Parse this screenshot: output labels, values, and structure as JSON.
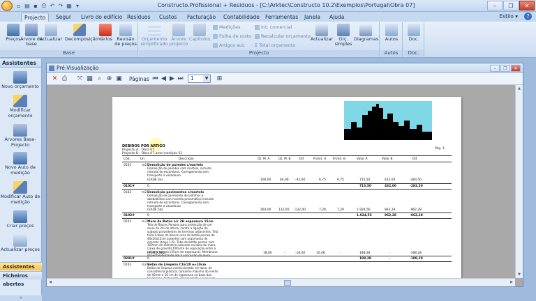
{
  "window": {
    "title": "Constructo.Profissional + Residuos - [C:\\Arktec\\Constructo 10.2\\Exemplos\\Portugal\\Obra 07]"
  },
  "tabs": [
    {
      "label": "Projecto",
      "active": true
    },
    {
      "label": "Segur"
    },
    {
      "label": "Livro do edifício"
    },
    {
      "label": "Resíduos"
    },
    {
      "label": "Custos"
    },
    {
      "label": "Facturação"
    },
    {
      "label": "Contabilidade"
    },
    {
      "label": "Ferramentas"
    },
    {
      "label": "Janela"
    },
    {
      "label": "Ajuda"
    }
  ],
  "style_label": "Estilo",
  "ribbon": {
    "base_group": "Base",
    "projecto_group": "Projecto",
    "autos_group": "Autos",
    "doc_group": "Doc.",
    "buttons": {
      "precos": "Preços",
      "arvore_base": "Árvore de base",
      "actualizar": "Actualizar",
      "decomposicao": "Decomposição",
      "varios": "Vários",
      "revisao_precos": "Revisão de preços",
      "orcamento_simplificado": "Orçamento simplificado",
      "arvore_projecto": "Árvore projecto",
      "capitulos": "Capítulos",
      "actualizar2": "Actualizar",
      "orc_simples": "Orç. simples",
      "diagramas": "Diagramas",
      "autos": "Autos",
      "doc": "Doc."
    },
    "small": {
      "medicoes": "Medições",
      "folha_rosto": "Folha de rosto",
      "artigos_aut": "Artigos aut.",
      "int_comercial": "Int. comercial",
      "recalcular": "Recalcular orçamento",
      "total_orcamento": "Total orçamento"
    }
  },
  "sidebar": {
    "header": "Assistentes",
    "items": [
      {
        "label": "Novo orçamento"
      },
      {
        "label": "Modificar orçamento"
      },
      {
        "label": "Árvores Base-Projecto"
      },
      {
        "label": "Novo Auto de medição"
      },
      {
        "label": "Modificar Auto de medição"
      },
      {
        "label": "Criar preços"
      },
      {
        "label": "Actualizar preços"
      }
    ],
    "bottom_selected": "Assistentes",
    "bottom_other": "Ficheiros abertos"
  },
  "preview": {
    "title": "Pré-Visualização",
    "pages_label": "Páginas",
    "page_value": "1"
  },
  "document": {
    "title": "DEBIDOS POR ARTIGO",
    "sub1": "Projecto A : Obra 07",
    "sub2": "Projecto B : Obra 07 auto medição 01",
    "page_label": "Pág. 1",
    "columns": [
      "Cód.",
      "Un",
      "Descrição",
      "Qt. M. A",
      "Qt. M. B",
      "Dif.",
      "P.Unit. A",
      "P.Unit. B",
      "Valor A",
      "Valor B",
      "Dif."
    ],
    "rows": [
      {
        "code": "0101",
        "un": "m2",
        "desc_title": "Demolição de paredes c/martelo",
        "desc": "Demolição de paredes com martelo, incluida retirada de escombros. Carregamento sem transporte a vazadouro.",
        "ref": "(EADE.3a)",
        "qa": "106,00",
        "qb": "64,00",
        "dif": "-42,00",
        "pa": "6,75",
        "pb": "6,75",
        "va": "715,50",
        "vb": "432,00",
        "vd": "-283,50",
        "sum_code": "0101#",
        "sum_q": "0",
        "sum_va": "715,50",
        "sum_vb": "432,00",
        "sum_vd": "-283,50"
      },
      {
        "code": "0102",
        "un": "m2",
        "desc_title": "Demolição pavimentos c/martelo",
        "desc": "Demolição de pavimento de ladrilhos e abobadilhas com martelo pneumático incluida retirada de escombros. Carregamento sem transporte a vazadouro.",
        "ref": "(EADE.5b)",
        "qa": "264,00",
        "qb": "132,00",
        "dif": "-132,00",
        "pa": "7,29",
        "pb": "7,29",
        "va": "1.924,56",
        "vb": "962,28",
        "vd": "-962,28",
        "sum_code": "0102#",
        "sum_q": "0",
        "sum_va": "1.924,56",
        "sum_vb": "962,28",
        "sum_vd": "-962,28"
      },
      {
        "code": "0201",
        "un": "m3",
        "desc_title": "Muro de Betão a/c 2H espessura 15cm",
        "desc": "Tela de Blocos Porosos para protecção de um muro de 2m de altura, contra a ligação do subsolo procedentes de terrenos adjacentes. Tela feita à base de blocos ocos de betão poroso de 40x20x12cm assentes com argamassa de cimento (traço 1:6). Tubo de betão poroso com 150mm de diâmetro colocado na base do muro. Caixa de gravilha filtrante de separação entre a tela e o terreno (25cm de espessura). Membrana impermeabilizante até à conclusão do muro.",
        "ref": "(ECMD.58b)",
        "qa": "18,00",
        "qb": "-",
        "dif": "-18,00",
        "pa": "10,46",
        "pb": "-",
        "va": "188,28",
        "vb": "-",
        "vd": "-188,28",
        "sum_code": "0201#",
        "sum_q": "0",
        "sum_va": "188,28",
        "sum_vb": "-",
        "sum_vd": "-188,28"
      },
      {
        "code": "0202",
        "un": "m2",
        "desc_title": "Betão de Limpeza C16/20 e=10cm",
        "desc": "Betão de limpeza confeccionado em obra, de consistência plástica, tamanho máximo do inerte de 40mm e 10 cm de espessura na base das fundações. Elaborado, Transportado e Colocado em obra."
      }
    ]
  },
  "colors": {
    "ribbon": "#dce8f6",
    "titlebar": "#c4d8f0",
    "close": "#c4412c",
    "selected": "#f7c148"
  }
}
